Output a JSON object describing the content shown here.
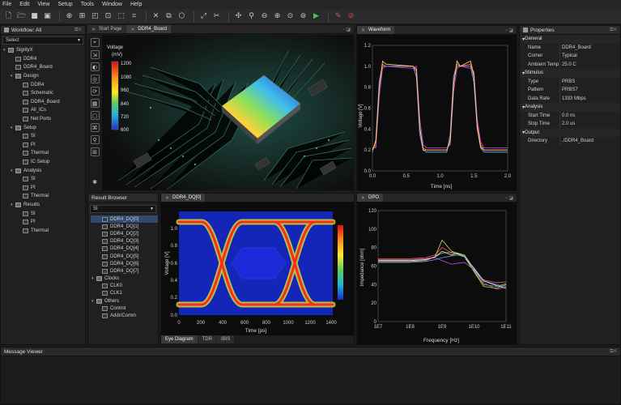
{
  "menu": [
    "File",
    "Edit",
    "View",
    "Setup",
    "Tools",
    "Window",
    "Help"
  ],
  "workflow": {
    "title": "Workflow: All",
    "select_value": "Select",
    "tree": [
      {
        "label": "SigrityX",
        "level": 0,
        "type": "root"
      },
      {
        "label": "DDR4",
        "level": 1,
        "type": "item"
      },
      {
        "label": "DDR4_Board",
        "level": 1,
        "type": "item"
      },
      {
        "label": "Design",
        "level": 1,
        "type": "folder"
      },
      {
        "label": "DDR4",
        "level": 2,
        "type": "item"
      },
      {
        "label": "Schematic",
        "level": 2,
        "type": "item"
      },
      {
        "label": "DDR4_Board",
        "level": 2,
        "type": "item"
      },
      {
        "label": "All_ICs",
        "level": 2,
        "type": "item"
      },
      {
        "label": "Net Ports",
        "level": 2,
        "type": "item"
      },
      {
        "label": "Setup",
        "level": 1,
        "type": "folder"
      },
      {
        "label": "SI",
        "level": 2,
        "type": "item"
      },
      {
        "label": "PI",
        "level": 2,
        "type": "item"
      },
      {
        "label": "Thermal",
        "level": 2,
        "type": "item"
      },
      {
        "label": "IC Setup",
        "level": 2,
        "type": "item"
      },
      {
        "label": "Analysis",
        "level": 1,
        "type": "folder"
      },
      {
        "label": "SI",
        "level": 2,
        "type": "item"
      },
      {
        "label": "PI",
        "level": 2,
        "type": "item"
      },
      {
        "label": "Thermal",
        "level": 2,
        "type": "item"
      },
      {
        "label": "Results",
        "level": 1,
        "type": "folder"
      },
      {
        "label": "SI",
        "level": 2,
        "type": "item"
      },
      {
        "label": "PI",
        "level": 2,
        "type": "item"
      },
      {
        "label": "Thermal",
        "level": 2,
        "type": "item"
      }
    ]
  },
  "tabs_top": {
    "start": "Start Page",
    "board": "DDR4_Board",
    "waveform": "Waveform"
  },
  "board_view": {
    "colorbar_title": "Voltage",
    "colorbar_unit": "(mV)",
    "colorbar_ticks": [
      "1200",
      "1080",
      "960",
      "840",
      "720",
      "600"
    ],
    "colors": {
      "high": "#e31a1c",
      "mid": "#ffd700",
      "low": "#1f3fd0"
    }
  },
  "waveform_chart": {
    "ylabel": "Voltage [V]",
    "xlabel": "Time [ns]",
    "yticks": [
      "1.2",
      "1.0",
      "0.8",
      "0.6",
      "0.4",
      "0.2",
      "0.0"
    ],
    "xticks": [
      "0.0",
      "0.5",
      "1.0",
      "1.5",
      "2.0"
    ]
  },
  "chart_data": [
    {
      "type": "line",
      "xlabel": "Time [ns]",
      "ylabel": "Voltage [V]",
      "xlim": [
        0,
        2.0
      ],
      "ylim": [
        0,
        1.2
      ],
      "series": [
        {
          "color": "#ff6a3a",
          "x": [
            0,
            0.05,
            0.1,
            0.15,
            0.2,
            0.6,
            0.65,
            0.7,
            0.75,
            0.8,
            1.1,
            1.15,
            1.2,
            1.25,
            1.3,
            1.45,
            1.5,
            1.55,
            1.6,
            1.65,
            2.0
          ],
          "y": [
            0.2,
            0.25,
            0.8,
            1.0,
            1.0,
            1.0,
            0.95,
            0.4,
            0.22,
            0.2,
            0.2,
            0.3,
            0.85,
            1.0,
            1.0,
            1.02,
            0.9,
            0.45,
            0.25,
            0.2,
            0.2
          ]
        },
        {
          "color": "#6fa0ff",
          "x": [
            0,
            0.05,
            0.1,
            0.15,
            0.2,
            0.6,
            0.65,
            0.7,
            0.75,
            0.8,
            1.1,
            1.15,
            1.2,
            1.25,
            1.3,
            1.45,
            1.5,
            1.55,
            1.6,
            1.65,
            2.0
          ],
          "y": [
            0.18,
            0.3,
            0.85,
            1.02,
            1.0,
            1.0,
            0.9,
            0.35,
            0.2,
            0.18,
            0.18,
            0.35,
            0.9,
            1.02,
            1.0,
            1.0,
            0.85,
            0.4,
            0.22,
            0.18,
            0.18
          ]
        },
        {
          "color": "#c040e0",
          "x": [
            0,
            0.05,
            0.1,
            0.15,
            0.2,
            0.6,
            0.65,
            0.7,
            0.75,
            0.8,
            1.1,
            1.15,
            1.2,
            1.25,
            1.3,
            1.45,
            1.5,
            1.55,
            1.6,
            1.65,
            2.0
          ],
          "y": [
            0.22,
            0.22,
            0.7,
            0.98,
            1.0,
            0.98,
            1.0,
            0.5,
            0.25,
            0.22,
            0.22,
            0.25,
            0.75,
            0.98,
            1.0,
            0.98,
            0.95,
            0.5,
            0.28,
            0.22,
            0.22
          ]
        },
        {
          "color": "#ffd24a",
          "x": [
            0,
            0.05,
            0.1,
            0.15,
            0.2,
            0.6,
            0.65,
            0.7,
            0.75,
            0.8,
            1.1,
            1.15,
            1.2,
            1.25,
            1.3,
            1.45,
            1.5,
            1.55,
            1.6,
            1.65,
            2.0
          ],
          "y": [
            0.2,
            0.28,
            0.78,
            1.05,
            1.02,
            1.0,
            0.97,
            0.42,
            0.2,
            0.2,
            0.2,
            0.28,
            0.82,
            1.05,
            1.0,
            1.05,
            0.92,
            0.42,
            0.23,
            0.2,
            0.2
          ]
        }
      ]
    },
    {
      "type": "heatmap",
      "xlabel": "Time [ps]",
      "ylabel": "Voltage [V]",
      "xlim": [
        0,
        1400
      ],
      "ylim": [
        0.0,
        1.1
      ],
      "xticks": [
        0,
        200,
        400,
        600,
        800,
        1000,
        1200,
        1400
      ],
      "yticks": [
        0.0,
        0.2,
        0.4,
        0.6,
        0.8,
        1.0
      ]
    },
    {
      "type": "line",
      "xlabel": "Frequency [Hz]",
      "ylabel": "Impedance [ohm]",
      "xscale": "log",
      "xlim": [
        10000000,
        100000000000
      ],
      "ylim": [
        0,
        120
      ],
      "xticks": [
        "1E7",
        "1E8",
        "1E9",
        "1E10",
        "1E11"
      ],
      "yticks": [
        0,
        20,
        40,
        60,
        80,
        100,
        120
      ],
      "series": [
        {
          "color": "#ff5a5a",
          "x": [
            10000000,
            100000000,
            300000000,
            600000000,
            1000000000,
            2000000000,
            3000000000,
            5000000000,
            10000000000,
            20000000000,
            50000000000,
            100000000000
          ],
          "y": [
            68,
            68,
            69,
            72,
            80,
            74,
            73,
            70,
            55,
            45,
            42,
            43
          ]
        },
        {
          "color": "#5ad05a",
          "x": [
            10000000,
            100000000,
            300000000,
            600000000,
            1000000000,
            2000000000,
            3000000000,
            5000000000,
            10000000000,
            20000000000,
            50000000000,
            100000000000
          ],
          "y": [
            66,
            66,
            67,
            70,
            74,
            75,
            73,
            71,
            55,
            40,
            38,
            41
          ]
        },
        {
          "color": "#f0d040",
          "x": [
            10000000,
            100000000,
            300000000,
            600000000,
            1000000000,
            2000000000,
            3000000000,
            5000000000,
            10000000000,
            20000000000,
            50000000000,
            100000000000
          ],
          "y": [
            65,
            65,
            66,
            70,
            88,
            76,
            74,
            70,
            54,
            38,
            36,
            40
          ]
        },
        {
          "color": "#6aa0ff",
          "x": [
            10000000,
            100000000,
            300000000,
            600000000,
            1000000000,
            2000000000,
            3000000000,
            5000000000,
            10000000000,
            20000000000,
            50000000000,
            100000000000
          ],
          "y": [
            64,
            64,
            65,
            67,
            69,
            71,
            72,
            70,
            58,
            44,
            40,
            38
          ]
        },
        {
          "color": "#c050e0",
          "x": [
            10000000,
            100000000,
            300000000,
            600000000,
            1000000000,
            2000000000,
            3000000000,
            5000000000,
            10000000000,
            20000000000,
            50000000000,
            100000000000
          ],
          "y": [
            67,
            67,
            68,
            69,
            66,
            62,
            63,
            64,
            56,
            42,
            35,
            37
          ]
        },
        {
          "color": "#e8e8e8",
          "x": [
            10000000,
            100000000,
            300000000,
            600000000,
            1000000000,
            2000000000,
            3000000000,
            5000000000,
            10000000000,
            20000000000,
            50000000000,
            100000000000
          ],
          "y": [
            66,
            66,
            67,
            70,
            76,
            72,
            74,
            72,
            57,
            44,
            39,
            36
          ]
        }
      ]
    }
  ],
  "eye_chart": {
    "ylabel": "Voltage [V]",
    "xlabel": "Time [ps]",
    "yticks": [
      "1.0",
      "0.8",
      "0.6",
      "0.4",
      "0.2",
      "0.0"
    ],
    "xticks": [
      "0",
      "200",
      "400",
      "600",
      "800",
      "1000",
      "1200",
      "1400"
    ]
  },
  "impedance_chart": {
    "ylabel": "Impedance [ohm]",
    "xlabel": "Frequency [Hz]",
    "yticks": [
      "120",
      "100",
      "80",
      "60",
      "40",
      "20",
      "0"
    ],
    "xticks": [
      "1E7",
      "1E8",
      "1E9",
      "1E10",
      "1E11"
    ]
  },
  "result_browser": {
    "title": "Result Browser",
    "select_value": "SI",
    "items": [
      {
        "label": "DDR4_DQ[0]",
        "level": 1,
        "selected": true
      },
      {
        "label": "DDR4_DQ[1]",
        "level": 1
      },
      {
        "label": "DDR4_DQ[2]",
        "level": 1
      },
      {
        "label": "DDR4_DQ[3]",
        "level": 1
      },
      {
        "label": "DDR4_DQ[4]",
        "level": 1
      },
      {
        "label": "DDR4_DQ[5]",
        "level": 1
      },
      {
        "label": "DDR4_DQ[6]",
        "level": 1
      },
      {
        "label": "DDR4_DQ[7]",
        "level": 1
      },
      {
        "label": "Clocks",
        "level": 0
      },
      {
        "label": "CLK0",
        "level": 1
      },
      {
        "label": "CLK1",
        "level": 1
      },
      {
        "label": "Others",
        "level": 0
      },
      {
        "label": "Control",
        "level": 1
      },
      {
        "label": "Addr/Comm",
        "level": 1
      }
    ]
  },
  "tabs_bottom": {
    "dq": "DDR4_DQ[0]",
    "dpo": "DPO"
  },
  "analysis_tabs": [
    "Eye Diagram",
    "TDR",
    "IBIS"
  ],
  "properties": {
    "title": "Properties",
    "groups": [
      {
        "name": "General",
        "rows": [
          {
            "k": "Name",
            "v": "DDR4_Board"
          },
          {
            "k": "Corner",
            "v": "Typical"
          },
          {
            "k": "Ambient Temp",
            "v": "25.0 C"
          }
        ]
      },
      {
        "name": "Stimulus",
        "rows": [
          {
            "k": "Type",
            "v": "PRBS"
          },
          {
            "k": "Pattern",
            "v": "PRBS7"
          },
          {
            "k": "Data Rate",
            "v": "1333 Mbps"
          }
        ]
      },
      {
        "name": "Analysis",
        "rows": [
          {
            "k": "Start Time",
            "v": "0.0 ns"
          },
          {
            "k": "Stop Time",
            "v": "2.0 us"
          }
        ]
      },
      {
        "name": "Output",
        "rows": [
          {
            "k": "Directory",
            "v": "./DDR4_Board"
          }
        ]
      }
    ]
  },
  "message_viewer": {
    "title": "Message Viewer"
  }
}
